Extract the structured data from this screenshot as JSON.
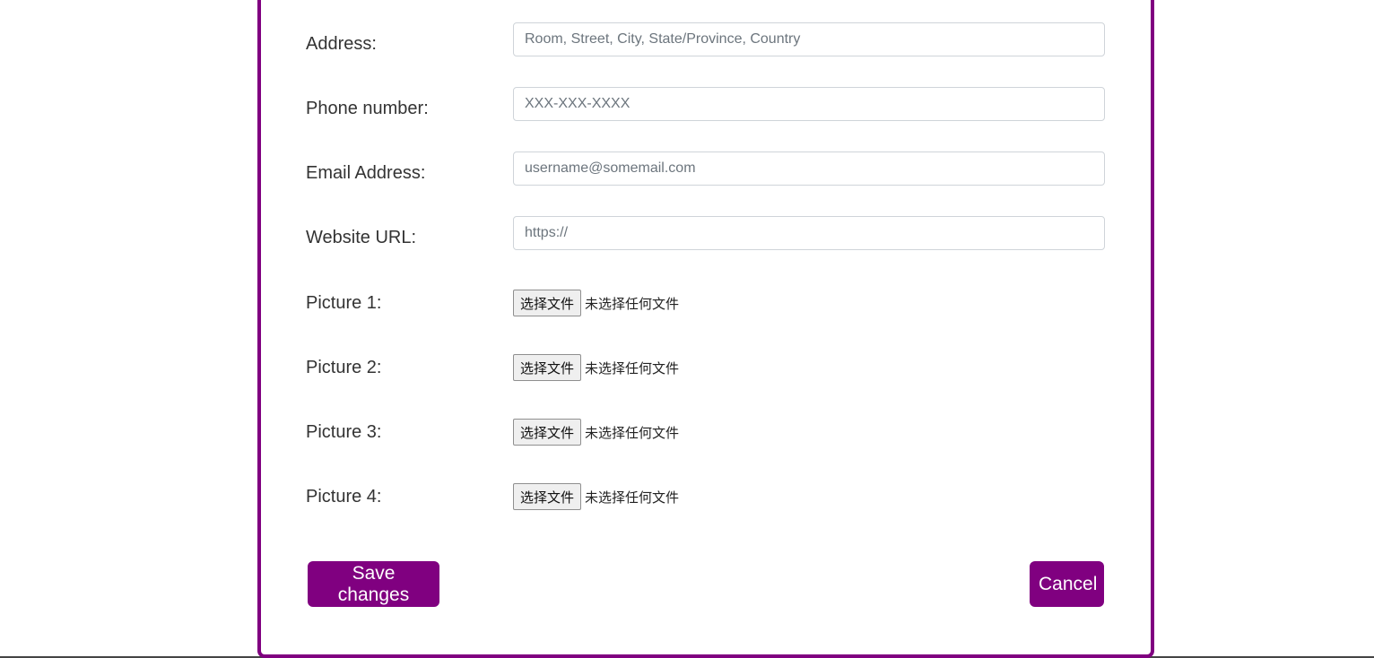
{
  "form": {
    "fields": [
      {
        "label": "Address:",
        "placeholder": "Room, Street, City, State/Province, Country",
        "value": ""
      },
      {
        "label": "Phone number:",
        "placeholder": "XXX-XXX-XXXX",
        "value": ""
      },
      {
        "label": "Email Address:",
        "placeholder": "username@somemail.com",
        "value": ""
      },
      {
        "label": "Website URL:",
        "placeholder": "https://",
        "value": ""
      }
    ],
    "pictures": [
      {
        "label": "Picture 1:",
        "button": "选择文件",
        "status": "未选择任何文件"
      },
      {
        "label": "Picture 2:",
        "button": "选择文件",
        "status": "未选择任何文件"
      },
      {
        "label": "Picture 3:",
        "button": "选择文件",
        "status": "未选择任何文件"
      },
      {
        "label": "Picture 4:",
        "button": "选择文件",
        "status": "未选择任何文件"
      }
    ],
    "actions": {
      "save_label": "Save changes",
      "cancel_label": "Cancel"
    }
  },
  "colors": {
    "accent": "#800080",
    "input_border": "#cfd4d9",
    "label_text": "#333333"
  }
}
